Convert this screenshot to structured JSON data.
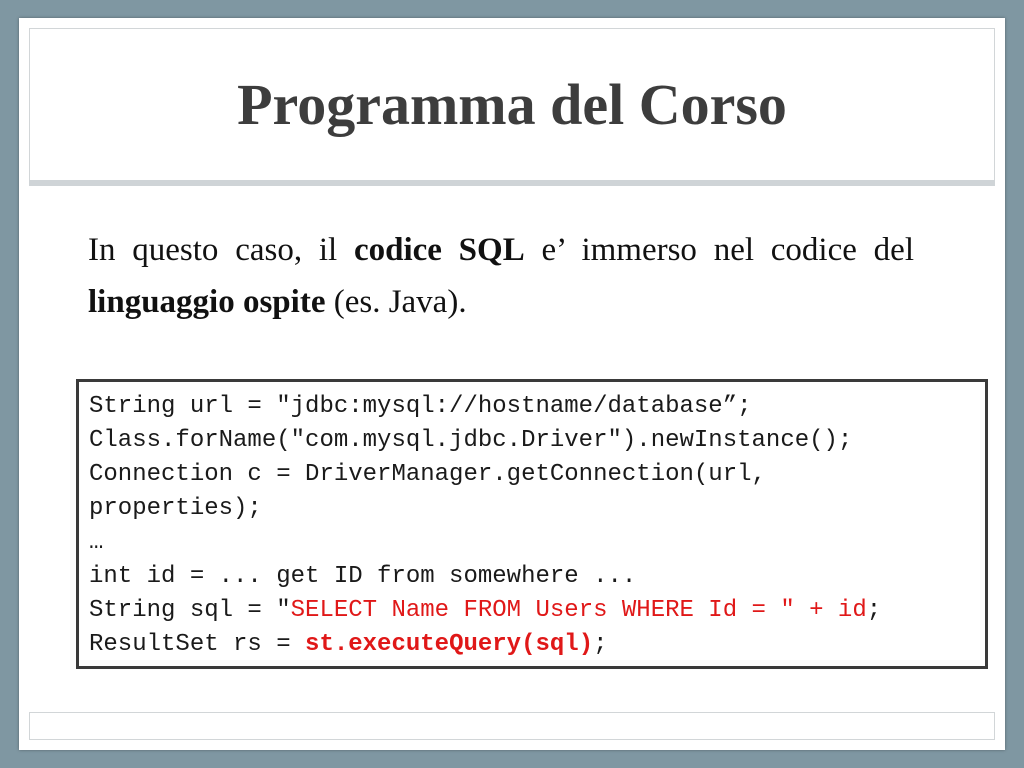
{
  "slide": {
    "title": "Programma del Corso",
    "paragraph": {
      "t1": "In questo caso, il ",
      "b1": "codice SQL",
      "t2": " e’ immerso nel codice del ",
      "b2": "linguaggio ospite",
      "t3": " (es. Java)."
    },
    "code": {
      "line1": "String url = \"jdbc:mysql://hostname/database”;",
      "line2": "Class.forName(\"com.mysql.jdbc.Driver\").newInstance();",
      "line3": "Connection c = DriverManager.getConnection(url,",
      "line4": "properties);",
      "line5": "…",
      "line6": "int id = ... get ID from somewhere ...",
      "line7_prefix": "String sql = \"",
      "line7_highlight": "SELECT Name FROM Users WHERE Id = \" + id",
      "line7_suffix": ";",
      "line8_prefix": "ResultSet rs = ",
      "line8_highlight": "st.executeQuery(sql)",
      "line8_suffix": ";"
    },
    "colors": {
      "background": "#7f97a2",
      "title": "#3d3d3d",
      "highlight": "#e01818"
    }
  }
}
